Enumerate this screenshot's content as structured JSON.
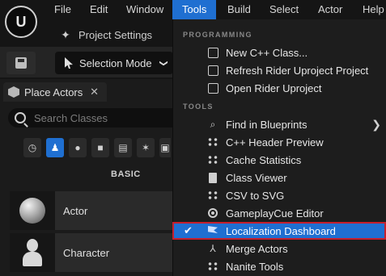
{
  "menubar": {
    "logo": "U",
    "items": [
      {
        "label": "File"
      },
      {
        "label": "Edit"
      },
      {
        "label": "Window"
      },
      {
        "label": "Tools"
      },
      {
        "label": "Build"
      },
      {
        "label": "Select"
      },
      {
        "label": "Actor"
      },
      {
        "label": "Help"
      }
    ]
  },
  "project_settings_label": "Project Settings",
  "toolbar": {
    "selection_mode_label": "Selection Mode",
    "selection_mode_chevron": "❯"
  },
  "place_actors": {
    "tab_label": "Place Actors",
    "close_glyph": "✕",
    "search_placeholder": "Search Classes",
    "basic_label": "BASIC",
    "actors": [
      {
        "label": "Actor"
      },
      {
        "label": "Character"
      }
    ]
  },
  "tools_menu": {
    "sections": {
      "programming": "PROGRAMMING",
      "tools": "TOOLS"
    },
    "items": [
      {
        "label": "New C++ Class..."
      },
      {
        "label": "Refresh Rider Uproject Project"
      },
      {
        "label": "Open Rider Uproject"
      },
      {
        "label": "Find in Blueprints",
        "submenu_arrow": "❯"
      },
      {
        "label": "C++ Header Preview"
      },
      {
        "label": "Cache Statistics"
      },
      {
        "label": "Class Viewer"
      },
      {
        "label": "CSV to SVG"
      },
      {
        "label": "GameplayCue Editor"
      },
      {
        "label": "Localization Dashboard",
        "check": "✔"
      },
      {
        "label": "Merge Actors"
      },
      {
        "label": "Nanite Tools"
      }
    ]
  },
  "colors": {
    "accent": "#1f6fd1",
    "highlight_border": "#c51f2d",
    "menu_bg": "#1d1d1d",
    "app_bg": "#151515"
  },
  "icons": {
    "logo": "unreal-logo-icon",
    "project_settings": "gear-icon",
    "save": "save-icon",
    "selection_mode": "cursor-icon",
    "place_actors": "cube-icon",
    "search": "search-icon"
  }
}
